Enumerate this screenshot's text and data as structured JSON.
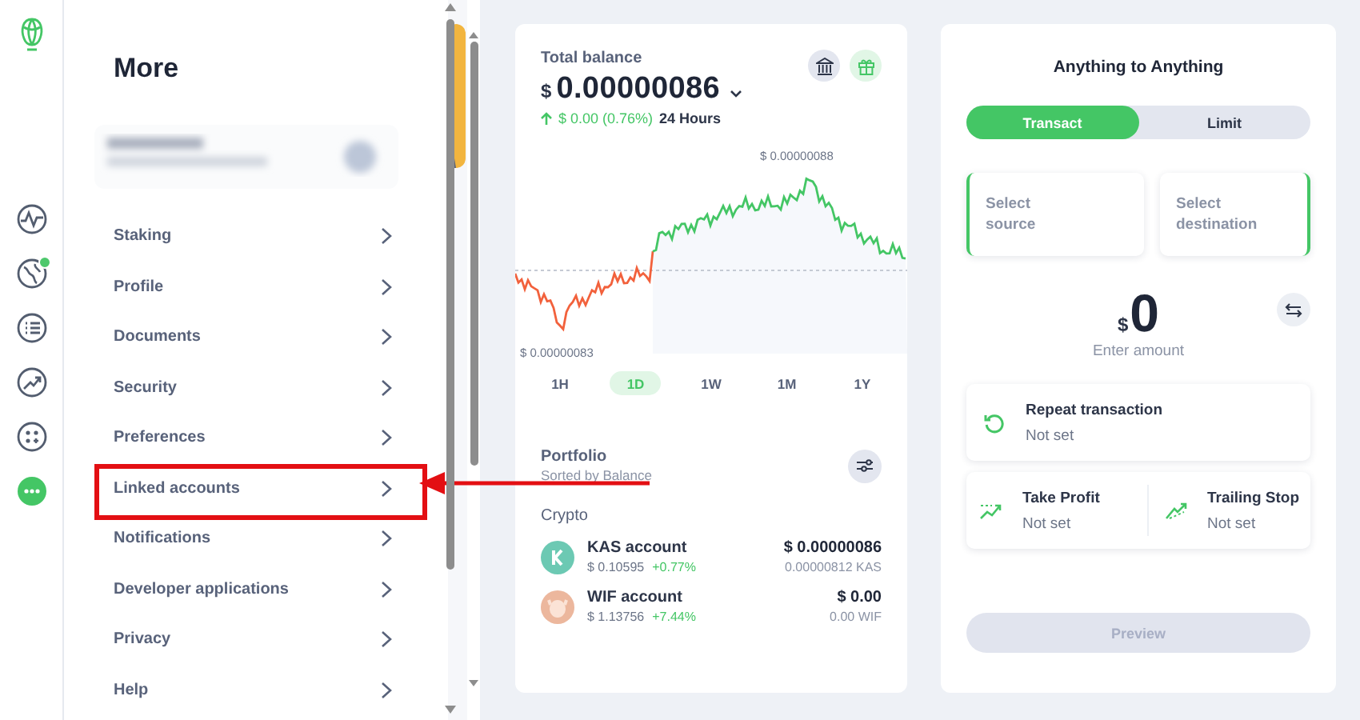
{
  "rail": {
    "items": [
      {
        "kind": "pulse",
        "selected": false,
        "badge": false
      },
      {
        "kind": "globe",
        "selected": false,
        "badge": true
      },
      {
        "kind": "list",
        "selected": false,
        "badge": false
      },
      {
        "kind": "trend",
        "selected": false,
        "badge": false
      },
      {
        "kind": "apps",
        "selected": false,
        "badge": false
      },
      {
        "kind": "more",
        "selected": true,
        "badge": false
      }
    ]
  },
  "more": {
    "title": "More",
    "items": [
      {
        "label": "Staking",
        "highlighted": false
      },
      {
        "label": "Profile",
        "highlighted": false
      },
      {
        "label": "Documents",
        "highlighted": false
      },
      {
        "label": "Security",
        "highlighted": false
      },
      {
        "label": "Preferences",
        "highlighted": false
      },
      {
        "label": "Linked accounts",
        "highlighted": true
      },
      {
        "label": "Notifications",
        "highlighted": false
      },
      {
        "label": "Developer applications",
        "highlighted": false
      },
      {
        "label": "Privacy",
        "highlighted": false
      },
      {
        "label": "Help",
        "highlighted": false
      }
    ]
  },
  "balance": {
    "title": "Total balance",
    "currency": "$",
    "amount": "0.00000086",
    "change": "$ 0.00 (0.76%)",
    "change_positive": true,
    "period": "24 Hours",
    "chart_high": "$ 0.00000088",
    "chart_low": "$ 0.00000083",
    "ranges": [
      {
        "label": "1H",
        "selected": false
      },
      {
        "label": "1D",
        "selected": true
      },
      {
        "label": "1W",
        "selected": false
      },
      {
        "label": "1M",
        "selected": false
      },
      {
        "label": "1Y",
        "selected": false
      }
    ],
    "portfolio": {
      "title": "Portfolio",
      "subtitle": "Sorted by Balance",
      "section": "Crypto",
      "accounts": [
        {
          "name": "KAS account",
          "price": "$ 0.10595",
          "change": "+0.77%",
          "change_positive": true,
          "value": "$ 0.00000086",
          "amount": "0.00000812 KAS",
          "color": "#6cc9b3"
        },
        {
          "name": "WIF account",
          "price": "$ 1.13756",
          "change": "+7.44%",
          "change_positive": true,
          "value": "$ 0.00",
          "amount": "0.00 WIF",
          "color": "#ecb79d"
        }
      ]
    }
  },
  "trade": {
    "title": "Anything to Anything",
    "modes": [
      {
        "label": "Transact",
        "selected": true
      },
      {
        "label": "Limit",
        "selected": false
      }
    ],
    "source": "Select source",
    "destination": "Select destination",
    "currency": "$",
    "amount": "0",
    "amount_hint": "Enter amount",
    "options": [
      {
        "kind": "repeat",
        "title": "Repeat transaction",
        "value": "Not set"
      }
    ],
    "targets": [
      {
        "kind": "profit",
        "title": "Take Profit",
        "value": "Not set"
      },
      {
        "kind": "stop",
        "title": "Trailing Stop",
        "value": "Not set"
      }
    ],
    "preview": {
      "label": "Preview",
      "disabled": true
    }
  }
}
